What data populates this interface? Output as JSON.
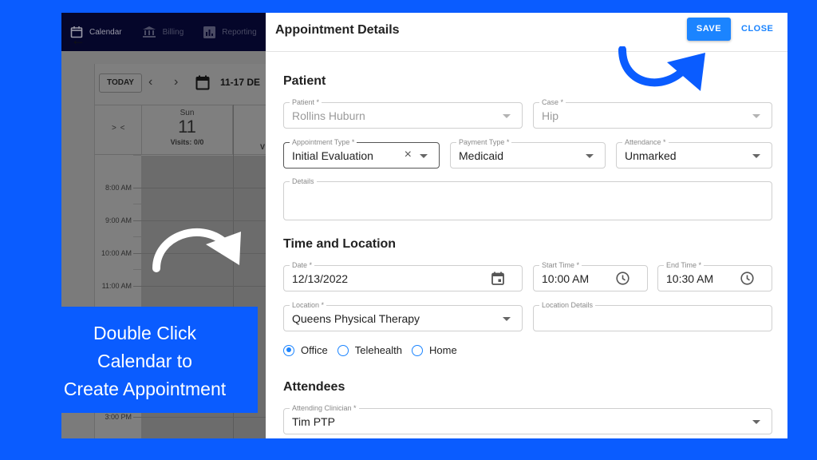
{
  "background_app": {
    "nav": [
      {
        "label": "Calendar",
        "icon": "calendar-icon"
      },
      {
        "label": "Billing",
        "icon": "bank-icon"
      },
      {
        "label": "Reporting",
        "icon": "bar-chart-icon"
      }
    ],
    "toolbar": {
      "today_label": "TODAY",
      "prev_icon": "‹",
      "next_icon": "›",
      "back_icon": "←",
      "range_label": "11-17 DE"
    },
    "collapse_label": "> <",
    "day": {
      "name": "Sun",
      "number": "11",
      "visits": "Visits: 0/0"
    },
    "next_day_visits": "V",
    "times": [
      "8:00 AM",
      "9:00 AM",
      "10:00 AM",
      "11:00 AM",
      "3:00 PM"
    ]
  },
  "callout": {
    "lines": [
      "Double Click",
      "Calendar to",
      "Create Appointment"
    ]
  },
  "modal": {
    "title": "Appointment Details",
    "save_label": "SAVE",
    "close_label": "CLOSE",
    "sections": {
      "patient": "Patient",
      "time_location": "Time and Location",
      "attendees": "Attendees"
    },
    "fields": {
      "patient": {
        "label": "Patient *",
        "value": "Rollins Huburn"
      },
      "case": {
        "label": "Case *",
        "value": "Hip"
      },
      "appointment_type": {
        "label": "Appointment Type *",
        "value": "Initial Evaluation",
        "clear_icon": "×"
      },
      "payment_type": {
        "label": "Payment Type *",
        "value": "Medicaid"
      },
      "attendance": {
        "label": "Attendance *",
        "value": "Unmarked"
      },
      "details": {
        "label": "Details",
        "value": ""
      },
      "date": {
        "label": "Date *",
        "value": "12/13/2022"
      },
      "start_time": {
        "label": "Start Time *",
        "value": "10:00 AM"
      },
      "end_time": {
        "label": "End Time *",
        "value": "10:30 AM"
      },
      "location": {
        "label": "Location *",
        "value": "Queens Physical Therapy"
      },
      "location_details": {
        "label": "Location Details",
        "value": ""
      },
      "attending_clinician": {
        "label": "Attending Clinician *",
        "value": "Tim PTP"
      }
    },
    "visit_mode": {
      "options": [
        "Office",
        "Telehealth",
        "Home"
      ],
      "selected": "Office"
    }
  },
  "colors": {
    "brand_blue": "#0a5cff",
    "primary_button": "#1b84ff",
    "nav_bg": "#05062a"
  }
}
